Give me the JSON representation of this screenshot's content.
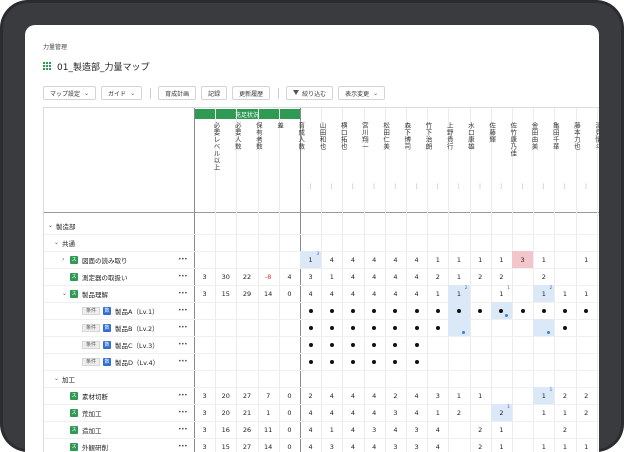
{
  "breadcrumb": "力量管理",
  "page_title": "01_製造部_力量マップ",
  "toolbar": {
    "map_settings": "マップ設定",
    "guide": "ガイド",
    "training_plan": "育成計画",
    "record": "記録",
    "history": "更新履歴",
    "filter": "絞り込む",
    "display_change": "表示変更"
  },
  "table": {
    "group_header": "充足状況",
    "metric_headers": [
      "必要レベル以上",
      "必要人数",
      "保有者数",
      "差",
      "育成人数"
    ],
    "person_headers": [
      "山田和也",
      "横口拓也",
      "宮川翔一",
      "松田仁美",
      "森下博司",
      "竹下治朗",
      "上野貴行",
      "水口康雄",
      "佐藤輝",
      "佐竹康乃佳",
      "金田由美",
      "亀田千華",
      "藤本力也",
      "清見慎斗"
    ],
    "header_menu": "⋮",
    "more_menu": "•••",
    "row_badge_skill": "ス",
    "row_badge_number": "数",
    "row_tag": "条件",
    "rows": [
      {
        "label": "製造部",
        "metrics": [
          "",
          "",
          "",
          "",
          ""
        ],
        "cells": []
      },
      {
        "label": "共通",
        "metrics": [
          "",
          "",
          "",
          "",
          ""
        ],
        "cells": []
      },
      {
        "label": "図面の読み取り",
        "metrics": [
          "",
          "",
          "",
          "",
          ""
        ],
        "cells": [
          "1",
          "4",
          "4",
          "4",
          "4",
          "4",
          "1",
          "1",
          "1",
          "1",
          "3",
          "1",
          "",
          "1"
        ]
      },
      {
        "label": "測定器の取扱い",
        "metrics": [
          "3",
          "30",
          "22",
          "-8",
          "4"
        ],
        "cells": [
          "3",
          "1",
          "4",
          "4",
          "4",
          "4",
          "2",
          "1",
          "2",
          "2",
          "",
          "2",
          "",
          ""
        ]
      },
      {
        "label": "製品理解",
        "metrics": [
          "3",
          "15",
          "29",
          "14",
          "0"
        ],
        "cells": [
          "4",
          "4",
          "4",
          "4",
          "4",
          "4",
          "1",
          "1",
          "",
          "1",
          "",
          "1",
          "1",
          "1"
        ]
      },
      {
        "label": "製品A（Lv.1）",
        "metrics": [
          "",
          "",
          "",
          "",
          ""
        ],
        "cells": [
          "●",
          "●",
          "●",
          "●",
          "●",
          "●",
          "●",
          "●",
          "●",
          "●",
          "●",
          "●",
          "●",
          "●"
        ]
      },
      {
        "label": "製品B（Lv.2）",
        "metrics": [
          "",
          "",
          "",
          "",
          ""
        ],
        "cells": [
          "●",
          "●",
          "●",
          "●",
          "●",
          "●",
          "●",
          "",
          "",
          "",
          "",
          "",
          "●",
          ""
        ]
      },
      {
        "label": "製品C（Lv.3）",
        "metrics": [
          "",
          "",
          "",
          "",
          ""
        ],
        "cells": [
          "●",
          "●",
          "●",
          "●",
          "●",
          "●",
          "",
          "",
          "",
          "",
          "",
          "",
          "",
          ""
        ]
      },
      {
        "label": "製品D（Lv.4）",
        "metrics": [
          "",
          "",
          "",
          "",
          ""
        ],
        "cells": [
          "●",
          "●",
          "●",
          "●",
          "●",
          "●",
          "",
          "",
          "",
          "",
          "",
          "",
          "",
          ""
        ]
      },
      {
        "label": "加工",
        "metrics": [
          "",
          "",
          "",
          "",
          ""
        ],
        "cells": []
      },
      {
        "label": "素材切断",
        "metrics": [
          "3",
          "20",
          "27",
          "7",
          "0"
        ],
        "cells": [
          "2",
          "4",
          "4",
          "4",
          "2",
          "4",
          "3",
          "1",
          "1",
          "",
          "",
          "1",
          "2",
          "2"
        ]
      },
      {
        "label": "荒加工",
        "metrics": [
          "3",
          "20",
          "21",
          "1",
          "0"
        ],
        "cells": [
          "4",
          "4",
          "4",
          "4",
          "3",
          "4",
          "1",
          "2",
          "",
          "2",
          "",
          "1",
          "1",
          "2"
        ]
      },
      {
        "label": "造加工",
        "metrics": [
          "3",
          "16",
          "26",
          "11",
          "0"
        ],
        "cells": [
          "4",
          "1",
          "4",
          "3",
          "4",
          "3",
          "4",
          "",
          "2",
          "1",
          "",
          "",
          "2",
          ""
        ]
      },
      {
        "label": "外観研削",
        "metrics": [
          "3",
          "15",
          "27",
          "14",
          "0"
        ],
        "cells": [
          "4",
          "3",
          "4",
          "4",
          "3",
          "3",
          "4",
          "",
          "2",
          "1",
          "",
          "1",
          "1",
          "1"
        ]
      }
    ]
  }
}
